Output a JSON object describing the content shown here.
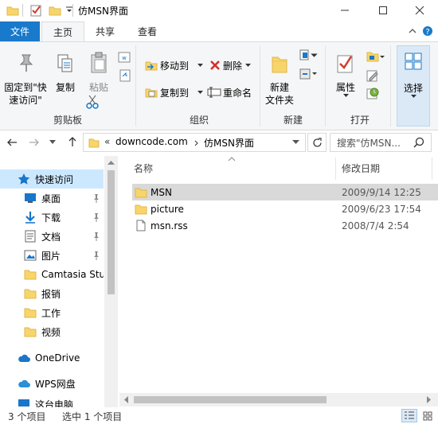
{
  "window": {
    "title": "仿MSN界面"
  },
  "ribbon_tabs": {
    "file": "文件",
    "home": "主页",
    "share": "共享",
    "view": "查看"
  },
  "ribbon": {
    "pin_quick_access": [
      "固定到\"快",
      "速访问\""
    ],
    "copy": "复制",
    "paste": "粘贴",
    "move_to": "移动到",
    "delete": "删除",
    "copy_to": "复制到",
    "rename": "重命名",
    "new_folder": [
      "新建",
      "文件夹"
    ],
    "properties": "属性",
    "select": "选择",
    "groups": {
      "clipboard": "剪贴板",
      "organize": "组织",
      "new": "新建",
      "open": "打开"
    }
  },
  "address": {
    "chevrons": "«",
    "path": [
      "downcode.com",
      "仿MSN界面"
    ],
    "search_placeholder": "搜索\"仿MSN..."
  },
  "nav": {
    "quick_access": "快速访问",
    "items": [
      "桌面",
      "下载",
      "文档",
      "图片",
      "Camtasia Studio",
      "报销",
      "工作",
      "视频"
    ],
    "onedrive": "OneDrive",
    "wps": "WPS网盘",
    "more": "这台电脑"
  },
  "columns": {
    "name": "名称",
    "modified": "修改日期"
  },
  "files": [
    {
      "name": "MSN",
      "date": "2009/9/14 12:25",
      "type": "folder"
    },
    {
      "name": "picture",
      "date": "2009/6/23 17:54",
      "type": "folder"
    },
    {
      "name": "msn.rss",
      "date": "2008/7/4 2:54",
      "type": "file"
    }
  ],
  "status": {
    "count": "3 个项目",
    "selected": "选中 1 个项目"
  },
  "colors": {
    "accent": "#1979ca",
    "folder": "#f8d56b",
    "selection": "#d9d9d9"
  }
}
